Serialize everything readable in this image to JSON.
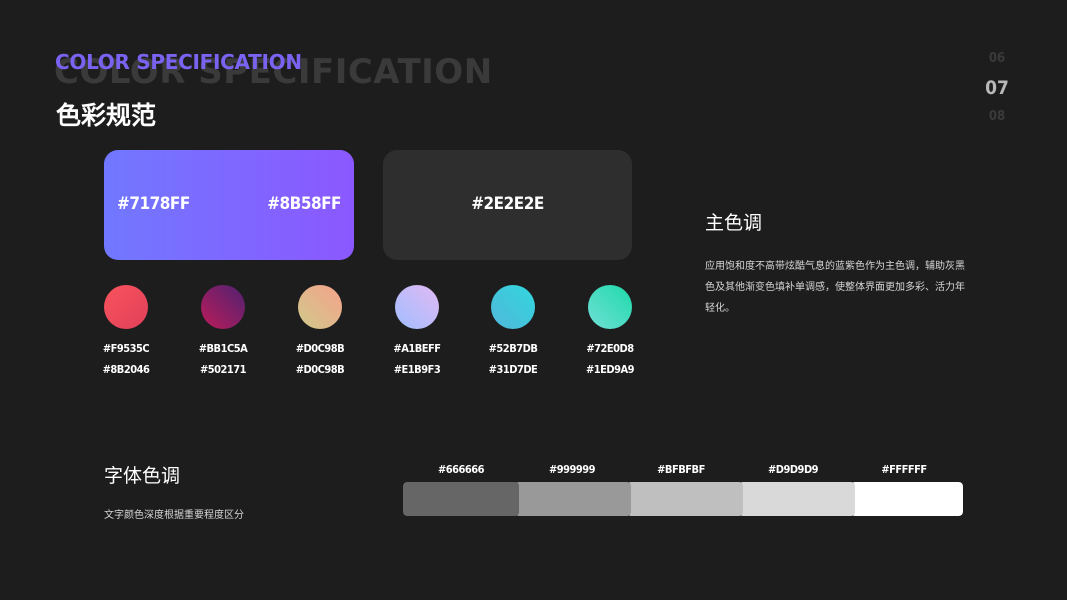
{
  "header": {
    "bg_title": "COLOR SPECIFICATION",
    "title_en": "COLOR SPECIFICATION",
    "title_cn": "色彩规范"
  },
  "pagination": {
    "prev": "06",
    "current": "07",
    "next": "08"
  },
  "main_colors": {
    "card_left": "#7178FF",
    "card_right": "#8B58FF",
    "card_gray": "#2E2E2E"
  },
  "gradients": [
    {
      "top": "#F9535C",
      "bottom": "#8B2046"
    },
    {
      "top": "#BB1C5A",
      "bottom": "#502171"
    },
    {
      "top": "#D0C98B",
      "bottom": "#D0C98B"
    },
    {
      "top": "#A1BEFF",
      "bottom": "#E1B9F3"
    },
    {
      "top": "#52B7DB",
      "bottom": "#31D7DE"
    },
    {
      "top": "#72E0D8",
      "bottom": "#1ED9A9"
    }
  ],
  "main_tone": {
    "title": "主色调",
    "description": "应用饱和度不高带炫酷气息的蓝紫色作为主色调，辅助灰黑色及其他渐变色填补单调感，使整体界面更加多彩、活力年轻化。"
  },
  "font_tone": {
    "title": "字体色调",
    "description": "文字颜色深度根据重要程度区分"
  },
  "font_colors": [
    "#666666",
    "#999999",
    "#BFBFBF",
    "#D9D9D9",
    "#FFFFFF"
  ]
}
